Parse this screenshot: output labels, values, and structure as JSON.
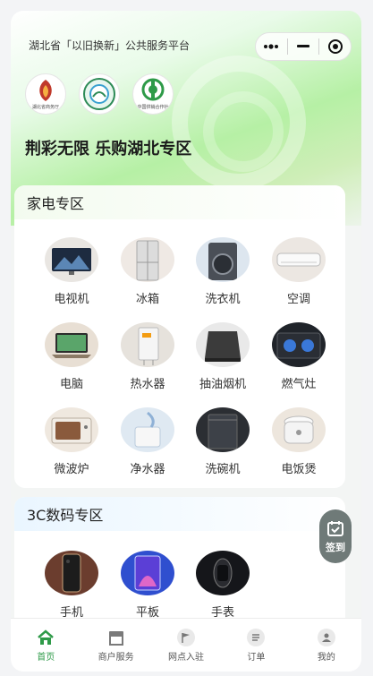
{
  "header": {
    "platform_title": "湖北省「以旧换新」公共服务平台",
    "slogan": "荆彩无限 乐购湖北专区"
  },
  "logos": [
    {
      "name": "湖北省商务厅",
      "icon": "hubei-commerce-logo"
    },
    {
      "name": "湖北消费券",
      "icon": "hubei-consumption-logo"
    },
    {
      "name": "中国供销合作社",
      "icon": "supply-coop-logo"
    }
  ],
  "appliances": {
    "title": "家电专区",
    "items": [
      {
        "label": "电视机"
      },
      {
        "label": "冰箱"
      },
      {
        "label": "洗衣机"
      },
      {
        "label": "空调"
      },
      {
        "label": "电脑"
      },
      {
        "label": "热水器"
      },
      {
        "label": "抽油烟机"
      },
      {
        "label": "燃气灶"
      },
      {
        "label": "微波炉"
      },
      {
        "label": "净水器"
      },
      {
        "label": "洗碗机"
      },
      {
        "label": "电饭煲"
      }
    ]
  },
  "digital": {
    "title": "3C数码专区",
    "items": [
      {
        "label": "手机"
      },
      {
        "label": "平板"
      },
      {
        "label": "手表"
      }
    ]
  },
  "sign_in": {
    "label": "签到"
  },
  "tabbar": {
    "items": [
      {
        "label": "首页",
        "icon": "home-icon",
        "active": true
      },
      {
        "label": "商户服务",
        "icon": "shop-icon"
      },
      {
        "label": "网点入驻",
        "icon": "flag-icon"
      },
      {
        "label": "订单",
        "icon": "order-icon"
      },
      {
        "label": "我的",
        "icon": "user-icon"
      }
    ]
  },
  "colors": {
    "accent": "#2e9a48",
    "hero": "#b6f0a5",
    "sign": "#6f7a78"
  }
}
